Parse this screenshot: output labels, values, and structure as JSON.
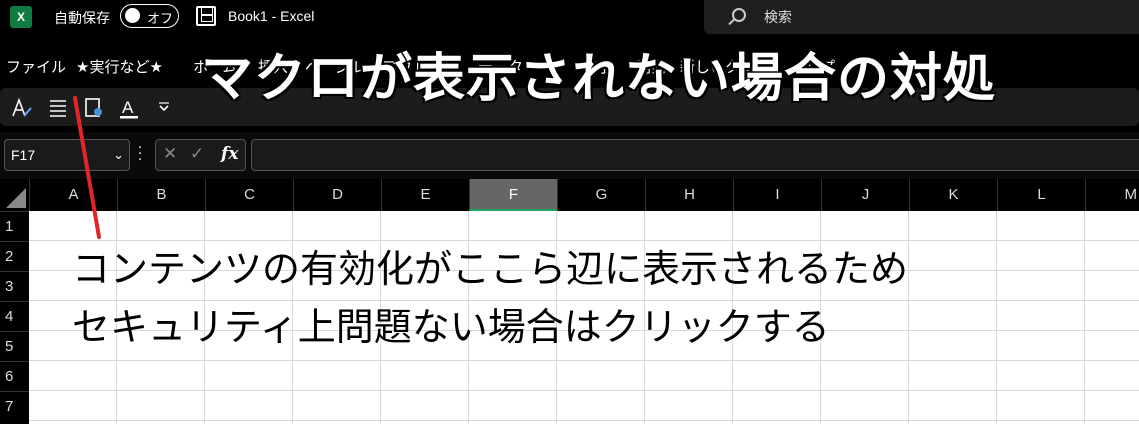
{
  "titlebar": {
    "app_icon": "excel-icon",
    "app_letter": "X",
    "autosave_label": "自動保存",
    "autosave_state": "オフ",
    "save_icon": "floppy-save-icon",
    "window_title": "Book1  -  Excel",
    "search_placeholder": "検索"
  },
  "menu": {
    "items": [
      "ファイル",
      "★実行など★",
      "ホーム",
      "挿入",
      "ページ",
      "レイアウト",
      "数式",
      "データ",
      "表示",
      "開発",
      "新しいタブ",
      "ヘルプ"
    ]
  },
  "ribbon": {
    "icons": [
      "text-format-icon",
      "align-icon",
      "object-select-icon",
      "font-color-icon",
      "dropdown-caret-icon"
    ],
    "font_color_letter": "A",
    "font_color_accent": "#ffffff"
  },
  "formula_bar": {
    "name_box": "F17",
    "fx_label": "fx",
    "content": ""
  },
  "grid": {
    "columns": [
      "A",
      "B",
      "C",
      "D",
      "E",
      "F",
      "G",
      "H",
      "I",
      "J",
      "K",
      "L",
      "M"
    ],
    "selected_column": "F",
    "rows": [
      "1",
      "2",
      "3",
      "4",
      "5",
      "6",
      "7"
    ]
  },
  "annotation": {
    "title": "マクロが表示されない場合の対処",
    "note_line1": "コンテンツの有効化がここら辺に表示されるため",
    "note_line2": "セキュリティ上問題ない場合はクリックする",
    "line_color": "#e0262a"
  }
}
